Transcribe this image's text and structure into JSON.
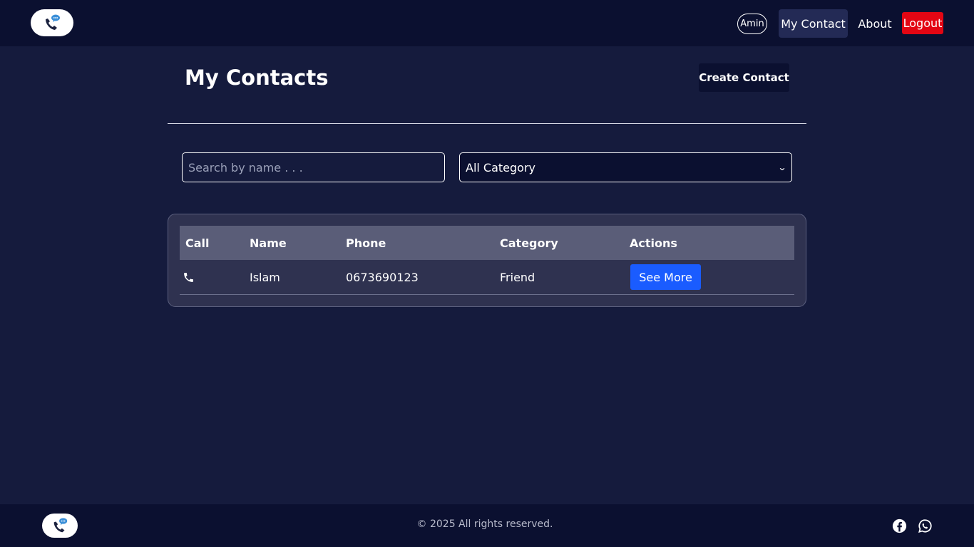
{
  "nav": {
    "logo_icon": "phone-chat-logo-icon",
    "user_initial": "Amin",
    "my_contact": "My Contact",
    "about": "About",
    "logout": "Logout"
  },
  "page": {
    "title": "My Contacts",
    "create_button": "Create Contact"
  },
  "filters": {
    "search_placeholder": "Search by name . . .",
    "search_value": "",
    "category_selected": "All Category"
  },
  "table": {
    "headers": {
      "call": "Call",
      "name": "Name",
      "phone": "Phone",
      "category": "Category",
      "actions": "Actions"
    },
    "rows": [
      {
        "call_icon": "phone-icon",
        "name": "Islam",
        "phone": "0673690123",
        "category": "Friend",
        "action_label": "See More"
      }
    ]
  },
  "footer": {
    "copyright": "© 2025 All rights reserved.",
    "social_icons": [
      "facebook-icon",
      "whatsapp-icon"
    ]
  },
  "colors": {
    "background": "#151b3d",
    "navbar": "#0b1030",
    "active_nav": "#232a55",
    "logout": "#e30613",
    "primary_button": "#1a5cff",
    "table_header": "#5a5d78",
    "table_body": "#2f3250"
  }
}
